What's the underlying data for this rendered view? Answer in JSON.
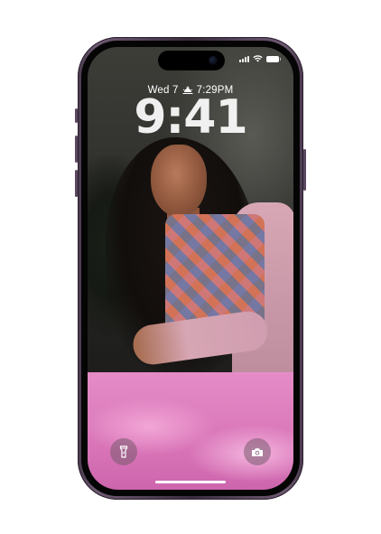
{
  "lockscreen": {
    "day_date": "Wed 7",
    "sunset_time": "7:29PM",
    "time": "9:41",
    "sunset_icon": "sunset-icon",
    "flashlight_icon": "flashlight-icon",
    "camera_icon": "camera-icon"
  },
  "status_bar": {
    "signal_icon": "cellular-signal-icon",
    "wifi_icon": "wifi-icon",
    "battery_icon": "battery-icon",
    "battery_level": 1.0
  },
  "colors": {
    "frame": "#4a3a4e",
    "skirt": "#e58cc7",
    "sleeve": "#d8a7b5"
  }
}
